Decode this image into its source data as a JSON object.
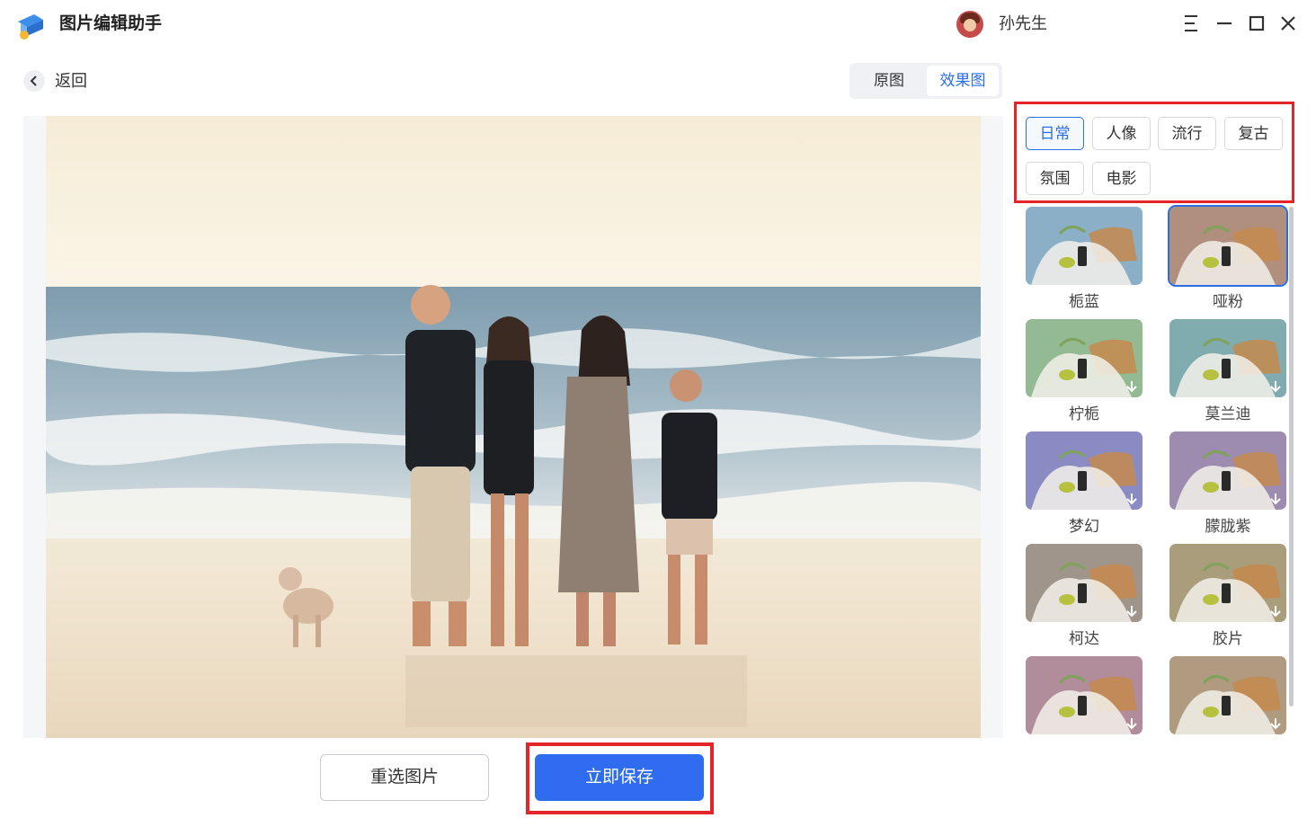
{
  "app": {
    "title": "图片编辑助手",
    "user_name": "孙先生",
    "logo_icon": "app-logo-icon"
  },
  "window_controls": [
    "menu-icon",
    "minimize-icon",
    "maximize-icon",
    "close-icon"
  ],
  "nav": {
    "back_label": "返回"
  },
  "view_toggle": {
    "original_label": "原图",
    "effect_label": "效果图",
    "active": "效果图"
  },
  "categories": [
    {
      "label": "日常",
      "active": true
    },
    {
      "label": "人像",
      "active": false
    },
    {
      "label": "流行",
      "active": false
    },
    {
      "label": "复古",
      "active": false
    },
    {
      "label": "氛围",
      "active": false
    },
    {
      "label": "电影",
      "active": false
    }
  ],
  "filters": [
    {
      "label": "栀蓝",
      "tint": "#9ec8e2",
      "downloadable": false,
      "selected": false
    },
    {
      "label": "哑粉",
      "tint": "#c9a391",
      "downloadable": false,
      "selected": true
    },
    {
      "label": "柠栀",
      "tint": "#a9d4a8",
      "downloadable": true,
      "selected": false
    },
    {
      "label": "莫兰迪",
      "tint": "#92c4c8",
      "downloadable": true,
      "selected": false
    },
    {
      "label": "梦幻",
      "tint": "#9f9fde",
      "downloadable": true,
      "selected": false
    },
    {
      "label": "朦胧紫",
      "tint": "#b39fc9",
      "downloadable": true,
      "selected": false
    },
    {
      "label": "柯达",
      "tint": "#b6aa9e",
      "downloadable": true,
      "selected": false
    },
    {
      "label": "胶片",
      "tint": "#c2b38e",
      "downloadable": true,
      "selected": false
    },
    {
      "label": "",
      "tint": "#caa0b0",
      "downloadable": true,
      "selected": false
    },
    {
      "label": "",
      "tint": "#c9b092",
      "downloadable": true,
      "selected": false
    }
  ],
  "actions": {
    "reselect_label": "重选图片",
    "save_label": "立即保存"
  },
  "colors": {
    "accent": "#2f6cf0",
    "highlight": "#e4262b"
  }
}
